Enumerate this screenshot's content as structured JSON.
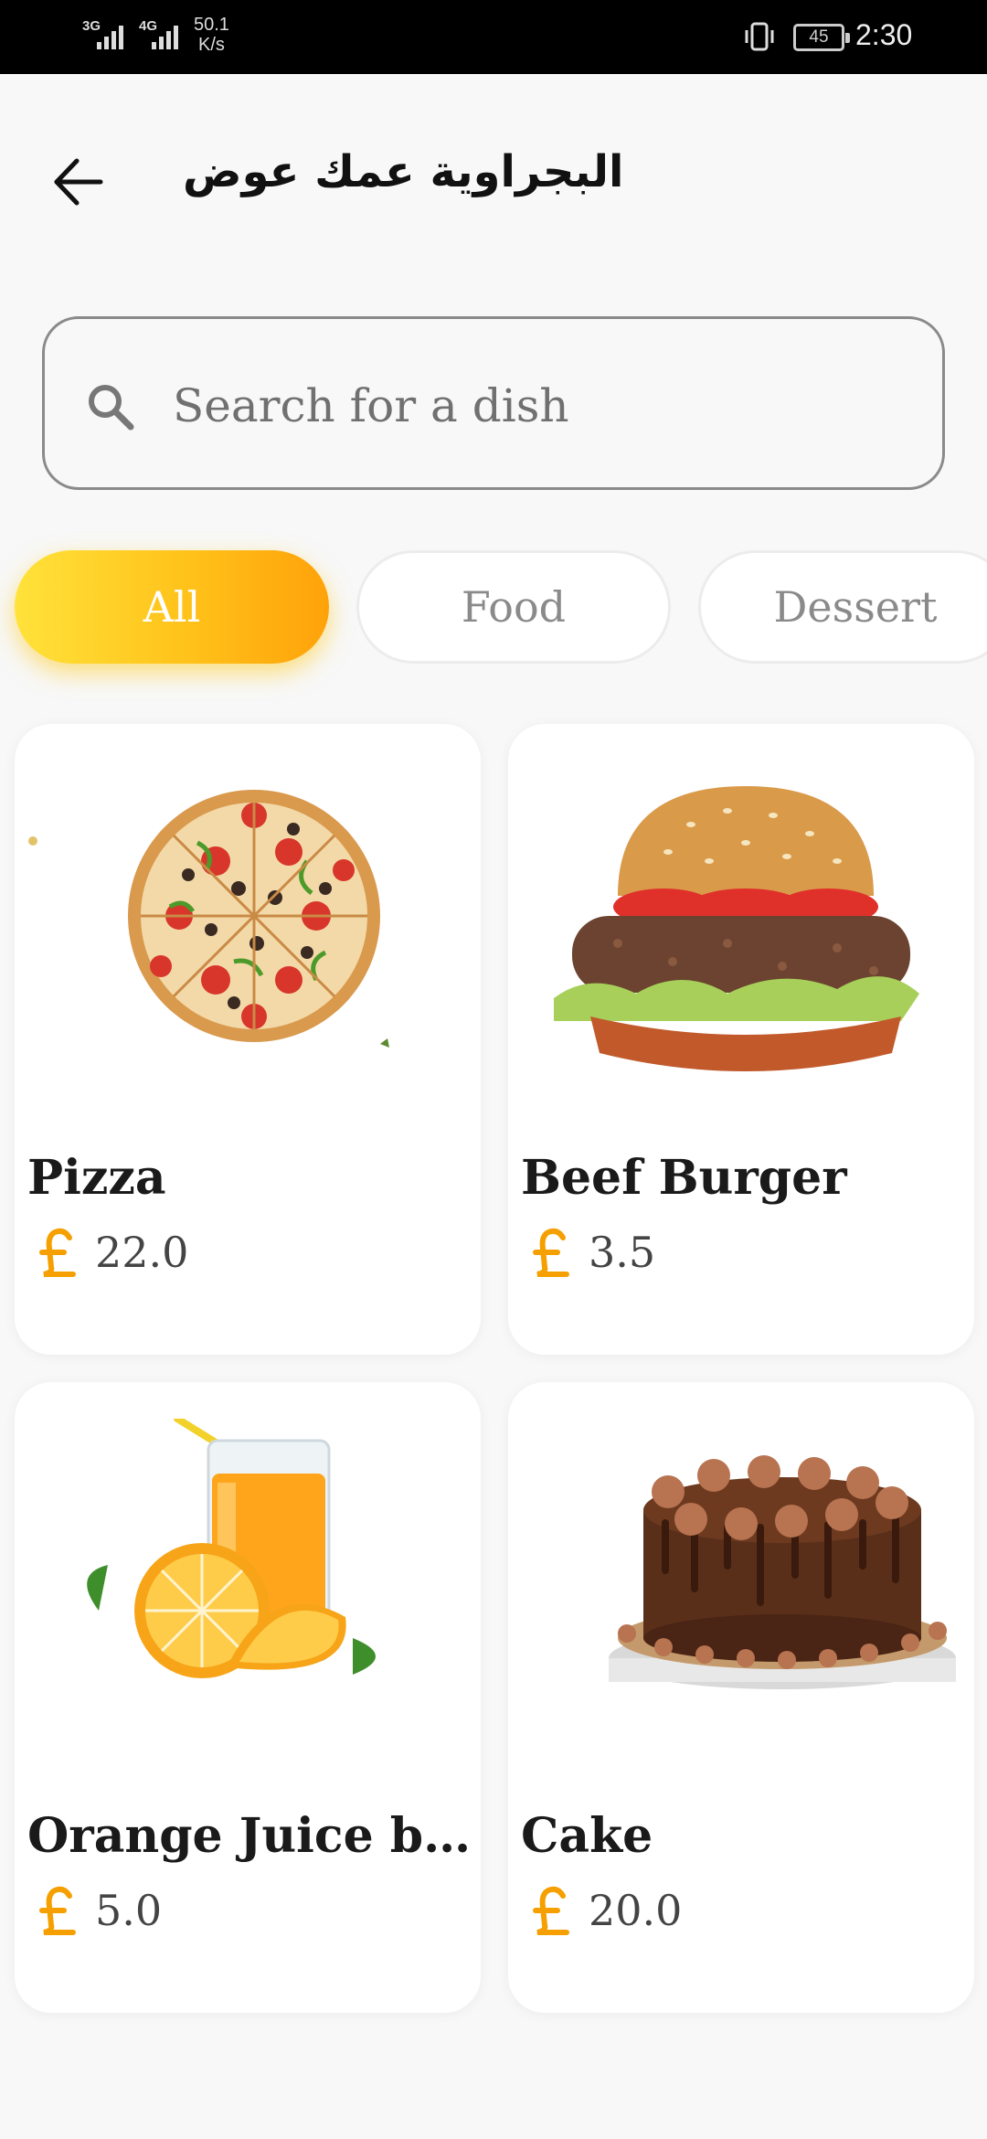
{
  "status_bar": {
    "network_1": "3G",
    "network_2": "4G",
    "speed_value": "50.1",
    "speed_unit": "K/s",
    "battery": "45",
    "time": "2:30"
  },
  "header": {
    "title": "البجراوية عمك عوض",
    "back_icon": "arrow-left-icon"
  },
  "search": {
    "placeholder": "Search for a dish",
    "value": "",
    "icon": "search-icon"
  },
  "categories": [
    {
      "label": "All",
      "active": true
    },
    {
      "label": "Food",
      "active": false
    },
    {
      "label": "Dessert",
      "active": false
    }
  ],
  "items": [
    {
      "name": "Pizza",
      "price": "22.0",
      "image": "pizza"
    },
    {
      "name": "Beef Burger",
      "price": "3.5",
      "image": "burger"
    },
    {
      "name": "Orange Juice big ...",
      "price": "5.0",
      "image": "orange-juice"
    },
    {
      "name": "Cake",
      "price": "20.0",
      "image": "chocolate-cake"
    }
  ],
  "colors": {
    "accent_start": "#ffe23a",
    "accent_end": "#ffa20a",
    "currency": "#f5a000",
    "background": "#f8f8f8"
  }
}
